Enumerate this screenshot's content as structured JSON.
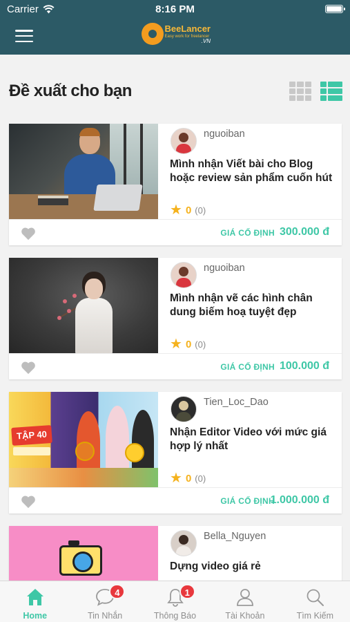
{
  "status_bar": {
    "carrier": "Carrier",
    "time": "8:16 PM"
  },
  "header": {
    "logo_name": "BeeLancer",
    "logo_domain": ".VN",
    "logo_tagline": "Easy work for freelancer"
  },
  "section": {
    "title": "Đề xuất cho bạn"
  },
  "view_toggle": {
    "grid_icon": "grid-view-icon",
    "list_icon": "list-view-icon",
    "active": "list"
  },
  "listings": [
    {
      "seller": "nguoiban",
      "title": "Mình nhận Viết bài cho Blog hoặc review sản phẩm cuốn hút",
      "rating": "0",
      "reviews": "(0)",
      "price_label": "GIÁ CỐ ĐỊNH",
      "price": "300.000 đ"
    },
    {
      "seller": "nguoiban",
      "title": "Mình nhận vẽ các hình chân dung biếm hoạ tuyệt đẹp",
      "rating": "0",
      "reviews": "(0)",
      "price_label": "GIÁ CỐ ĐỊNH",
      "price": "100.000 đ"
    },
    {
      "seller": "Tien_Loc_Dao",
      "title": "Nhận Editor Video với mức giá hợp lý nhất",
      "rating": "0",
      "reviews": "(0)",
      "price_label": "GIÁ CỐ ĐỊNH",
      "price": "1.000.000 đ",
      "thumb_banner": "TẬP 40"
    },
    {
      "seller": "Bella_Nguyen",
      "title": "Dựng video giá rẻ"
    }
  ],
  "tabbar": {
    "items": [
      {
        "label": "Home",
        "icon": "home-icon",
        "active": true
      },
      {
        "label": "Tin Nhắn",
        "icon": "chat-icon",
        "badge": "4"
      },
      {
        "label": "Thông Báo",
        "icon": "bell-icon",
        "badge": "1"
      },
      {
        "label": "Tài Khoản",
        "icon": "user-icon"
      },
      {
        "label": "Tìm Kiếm",
        "icon": "search-icon"
      }
    ]
  },
  "colors": {
    "header_bg": "#2c5a66",
    "accent": "#3ec7a6",
    "star": "#f5b21d",
    "badge": "#e8383d"
  }
}
